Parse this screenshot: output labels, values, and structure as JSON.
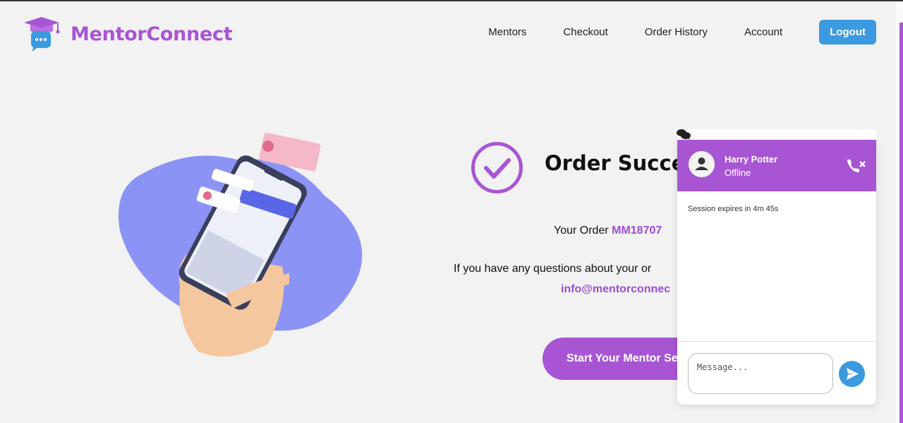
{
  "header": {
    "brand": "MentorConnect",
    "nav": [
      "Mentors",
      "Checkout",
      "Order History",
      "Account"
    ],
    "logout_label": "Logout"
  },
  "order": {
    "title": "Order Success",
    "order_prefix": "Your Order ",
    "order_code": "MM18707",
    "question_text": "If you have any questions about your or",
    "email": "info@mentorconnec",
    "start_button": "Start Your Mentor Se"
  },
  "chat": {
    "contact_name": "Harry Potter",
    "contact_status": "Offline",
    "session_text": "Session expires in 4m 45s",
    "message_placeholder": "Message..."
  },
  "colors": {
    "brand_purple": "#a855d4",
    "accent_blue": "#3b9ae0",
    "blob_blue": "#8b93f5"
  },
  "icons": [
    "graduation-cap-chat-logo-icon",
    "check-circle-icon",
    "chat-bubbles-icon",
    "user-avatar-icon",
    "end-call-icon",
    "send-icon"
  ]
}
